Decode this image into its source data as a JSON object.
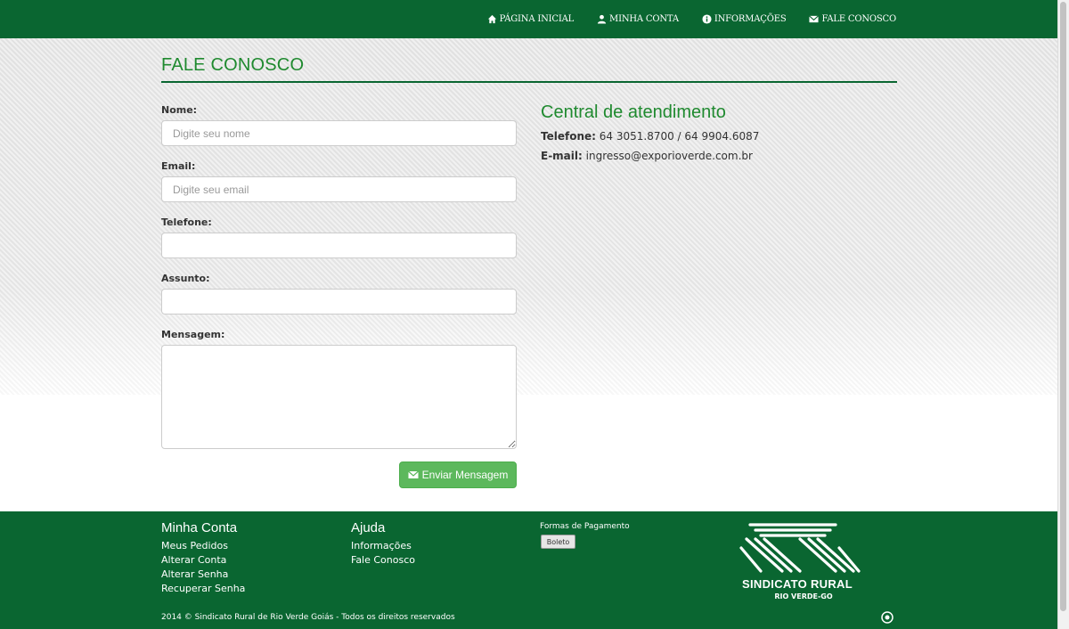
{
  "nav": {
    "home": "PÁGINA INICIAL",
    "account": "MINHA CONTA",
    "info": "INFORMAÇÕES",
    "contact": "FALE CONOSCO"
  },
  "page": {
    "title": "FALE CONOSCO"
  },
  "form": {
    "name_label": "Nome:",
    "name_placeholder": "Digite seu nome",
    "email_label": "Email:",
    "email_placeholder": "Digite seu email",
    "phone_label": "Telefone:",
    "phone_value": "",
    "subject_label": "Assunto:",
    "subject_value": "",
    "message_label": "Mensagem:",
    "message_value": "",
    "submit_label": "Enviar Mensagem"
  },
  "contact": {
    "title": "Central de atendimento",
    "phone_label": "Telefone:",
    "phone_value": "64 3051.8700 / 64 9904.6087",
    "email_label": "E-mail:",
    "email_value": "ingresso@exporioverde.com.br"
  },
  "footer": {
    "account_title": "Minha Conta",
    "account_links": [
      "Meus Pedidos",
      "Alterar Conta",
      "Alterar Senha",
      "Recuperar Senha"
    ],
    "help_title": "Ajuda",
    "help_links": [
      "Informações",
      "Fale Conosco"
    ],
    "payment_title": "Formas de Pagamento",
    "boleto": "Boleto",
    "copyright": "2014 © Sindicato Rural de Rio Verde Goiás - Todos os direitos reservados",
    "logo_line1": "SINDICATO RURAL",
    "logo_line2": "RIO VERDE-GO"
  },
  "colors": {
    "brand_green": "#0a6631",
    "title_green": "#1f8a2f",
    "button_green": "#5cb85c"
  }
}
